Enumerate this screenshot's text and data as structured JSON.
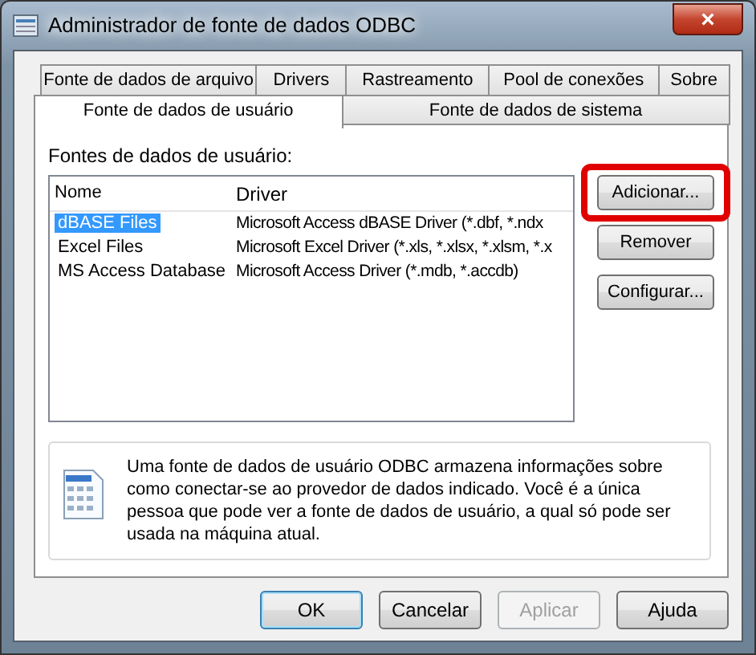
{
  "window": {
    "title": "Administrador de fonte de dados ODBC",
    "close": "×"
  },
  "tab_rows": [
    {
      "tabs": [
        {
          "label": "Fonte de dados de arquivo",
          "selected": false
        },
        {
          "label": "Drivers",
          "selected": false
        },
        {
          "label": "Rastreamento",
          "selected": false
        },
        {
          "label": "Pool de conexões",
          "selected": false
        },
        {
          "label": "Sobre",
          "selected": false
        }
      ]
    },
    {
      "tabs": [
        {
          "label": "Fonte de dados de usuário",
          "selected": true
        },
        {
          "label": "Fonte de dados de sistema",
          "selected": false
        }
      ]
    }
  ],
  "group_label": "Fontes de dados de usuário:",
  "table": {
    "columns": [
      "Nome",
      "Driver"
    ],
    "rows": [
      {
        "name": "dBASE Files",
        "driver": "Microsoft Access dBASE Driver (*.dbf, *.ndx",
        "selected": true
      },
      {
        "name": "Excel Files",
        "driver": "Microsoft Excel Driver (*.xls, *.xlsx, *.xlsm, *.x",
        "selected": false
      },
      {
        "name": "MS Access Database",
        "driver": "Microsoft Access Driver (*.mdb, *.accdb)",
        "selected": false
      }
    ]
  },
  "side_buttons": [
    {
      "label": "Adicionar...",
      "highlighted": true
    },
    {
      "label": "Remover",
      "highlighted": false
    },
    {
      "label": "Configurar...",
      "highlighted": false
    }
  ],
  "info": {
    "text": "Uma fonte de dados de usuário ODBC armazena informações sobre como conectar-se ao provedor de dados indicado. Você é a única pessoa que pode ver a fonte de dados de usuário, a qual só pode ser usada na máquina atual."
  },
  "buttons": [
    {
      "label": "OK",
      "default": true,
      "disabled": false
    },
    {
      "label": "Cancelar",
      "default": false,
      "disabled": false
    },
    {
      "label": "Aplicar",
      "default": false,
      "disabled": true
    },
    {
      "label": "Ajuda",
      "default": false,
      "disabled": false
    }
  ]
}
